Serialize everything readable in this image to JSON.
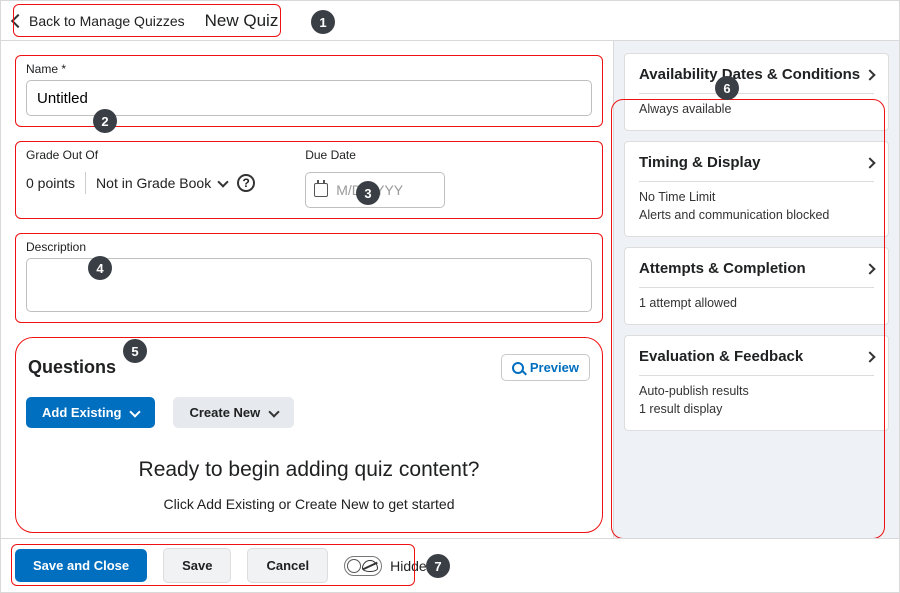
{
  "header": {
    "back_label": "Back to Manage Quizzes",
    "page_title": "New Quiz"
  },
  "name": {
    "label": "Name *",
    "value": "Untitled"
  },
  "grade": {
    "label": "Grade Out Of",
    "points": "0 points",
    "gradebook_status": "Not in Grade Book"
  },
  "due": {
    "label": "Due Date",
    "placeholder": "M/D/YYYY"
  },
  "description": {
    "label": "Description"
  },
  "questions": {
    "title": "Questions",
    "preview_label": "Preview",
    "add_existing_label": "Add Existing",
    "create_new_label": "Create New",
    "empty_heading": "Ready to begin adding quiz content?",
    "empty_sub": "Click Add Existing or Create New to get started"
  },
  "rail": [
    {
      "title": "Availability Dates & Conditions",
      "lines": [
        "Always available"
      ]
    },
    {
      "title": "Timing & Display",
      "lines": [
        "No Time Limit",
        "Alerts and communication blocked"
      ]
    },
    {
      "title": "Attempts & Completion",
      "lines": [
        "1 attempt allowed"
      ]
    },
    {
      "title": "Evaluation & Feedback",
      "lines": [
        "Auto-publish results",
        "1 result display"
      ]
    }
  ],
  "footer": {
    "save_close": "Save and Close",
    "save": "Save",
    "cancel": "Cancel",
    "visibility": "Hidden"
  },
  "markers": [
    "1",
    "2",
    "3",
    "4",
    "5",
    "6",
    "7"
  ]
}
